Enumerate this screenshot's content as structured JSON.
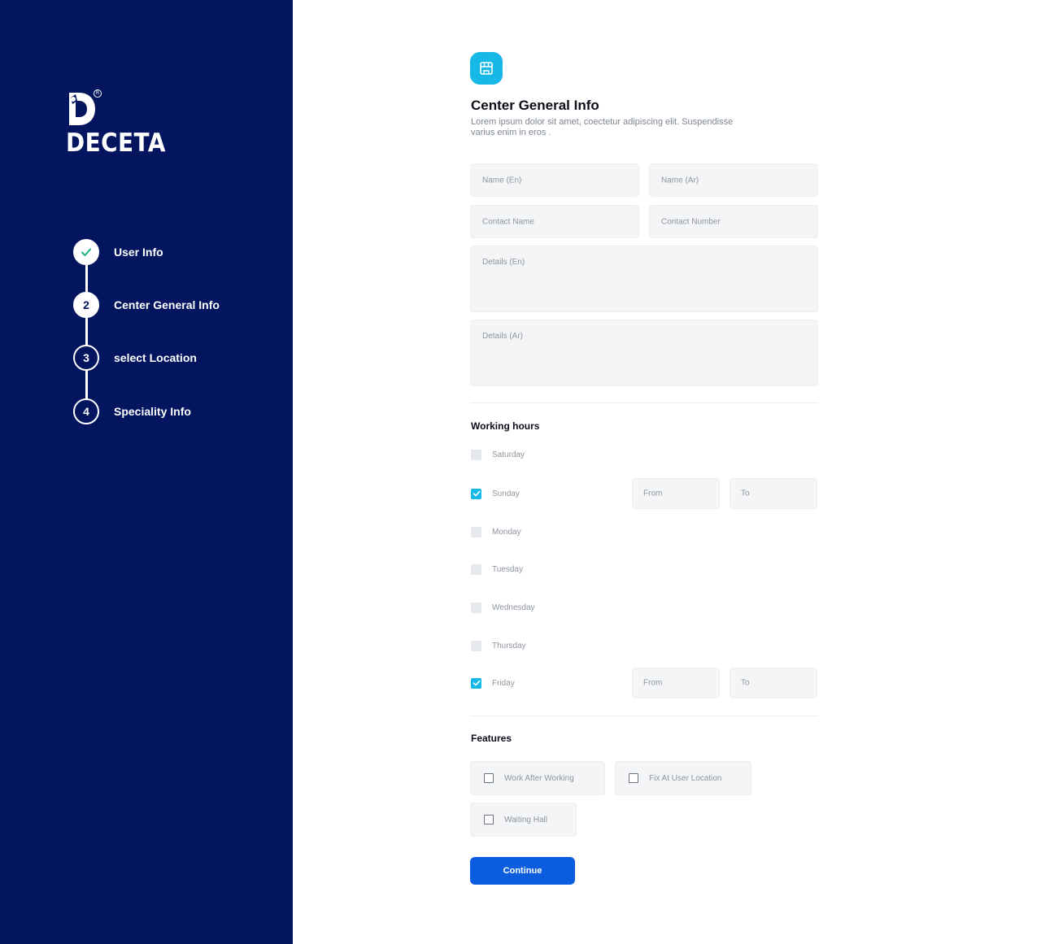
{
  "brand": {
    "name": "DECETA",
    "registered": "R"
  },
  "steps": [
    {
      "number": "",
      "label": "User Info",
      "state": "done"
    },
    {
      "number": "2",
      "label": "Center General Info",
      "state": "active"
    },
    {
      "number": "3",
      "label": "select Location",
      "state": "pending"
    },
    {
      "number": "4",
      "label": "Speciality Info",
      "state": "pending"
    }
  ],
  "header": {
    "icon": "store-icon",
    "title": "Center General Info",
    "description": "Lorem ipsum dolor sit amet, coectetur adipiscing elit. Suspendisse varius enim in eros ."
  },
  "form": {
    "name_en": "Name (En)",
    "name_ar": "Name (Ar)",
    "contact_name": "Contact Name",
    "contact_number": "Contact Number",
    "details_en": "Details (En)",
    "details_ar": "Details (Ar)"
  },
  "working_hours": {
    "title": "Working hours",
    "days": [
      {
        "label": "Saturday",
        "checked": false
      },
      {
        "label": "Sunday",
        "checked": true,
        "from": "From",
        "to": "To"
      },
      {
        "label": "Monday",
        "checked": false
      },
      {
        "label": "Tuesday",
        "checked": false
      },
      {
        "label": "Wednesday",
        "checked": false
      },
      {
        "label": "Thursday",
        "checked": false
      },
      {
        "label": "Friday",
        "checked": true,
        "from": "From",
        "to": "To"
      }
    ]
  },
  "features": {
    "title": "Features",
    "items": [
      {
        "label": "Work After Working",
        "checked": false
      },
      {
        "label": "Fix At User Location",
        "checked": false
      },
      {
        "label": "Waiting Hall",
        "checked": false
      }
    ]
  },
  "continue_label": "Continue",
  "colors": {
    "sidebar": "#03155f",
    "accent": "#15b8e6",
    "primary_button": "#0b5ddf",
    "check_green": "#1db27a"
  }
}
